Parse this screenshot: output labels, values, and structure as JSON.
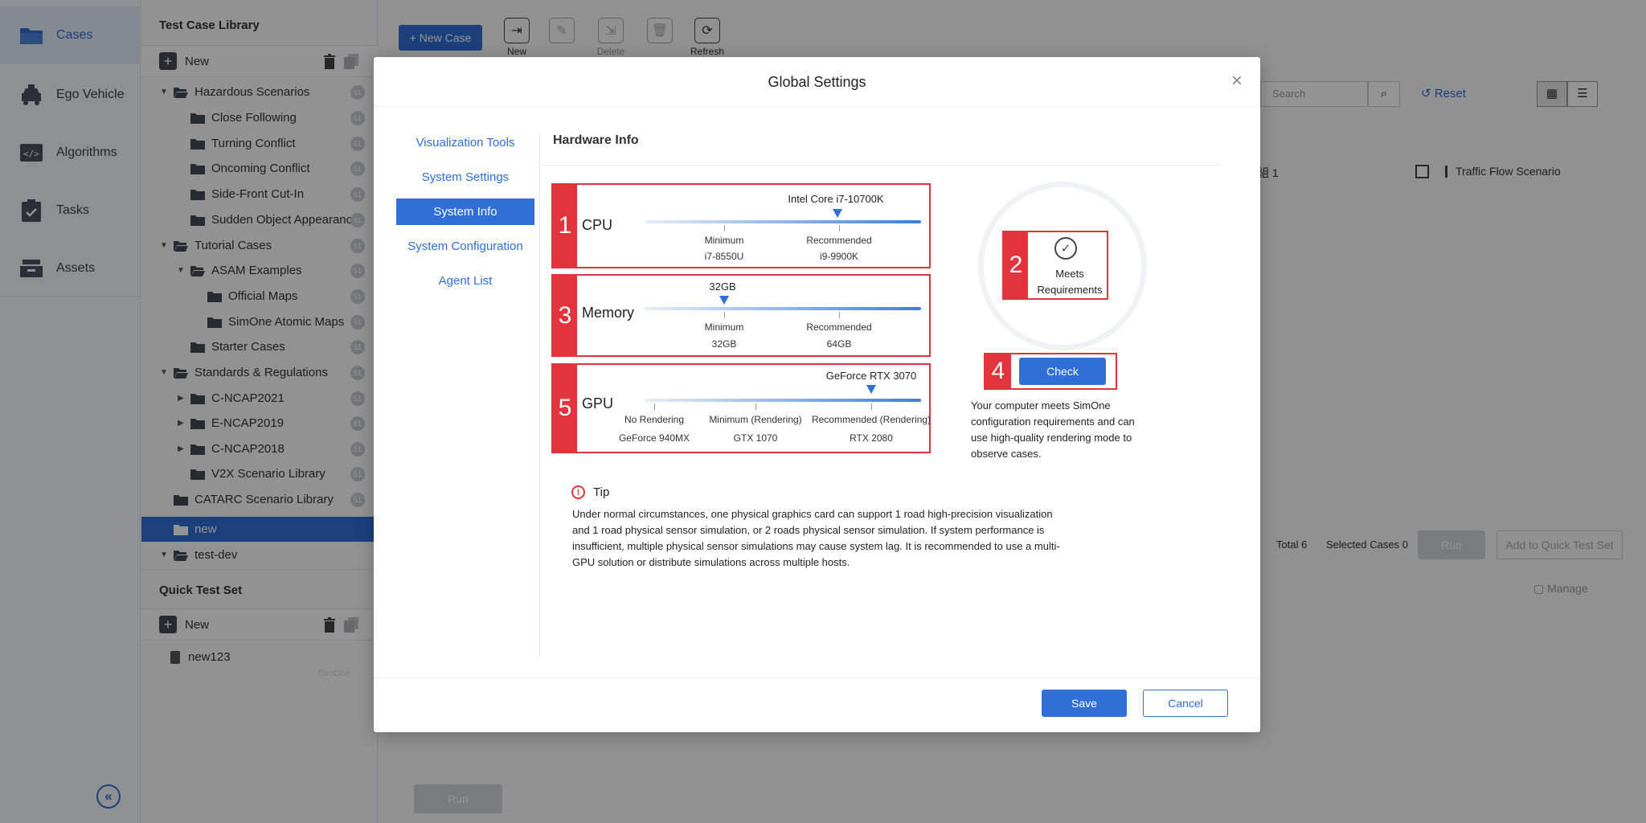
{
  "nav": {
    "items": [
      {
        "label": "Cases",
        "icon": "folder-icon"
      },
      {
        "label": "Ego Vehicle",
        "icon": "car-icon"
      },
      {
        "label": "Algorithms",
        "icon": "code-icon"
      },
      {
        "label": "Tasks",
        "icon": "clipboard-icon"
      },
      {
        "label": "Assets",
        "icon": "box-icon"
      }
    ],
    "collapse": "«"
  },
  "library": {
    "title": "Test Case Library",
    "new_label": "New",
    "items": [
      {
        "label": "Hazardous Scenarios",
        "badge": "51"
      },
      {
        "label": "Close Following",
        "badge": "51"
      },
      {
        "label": "Turning Conflict",
        "badge": "51"
      },
      {
        "label": "Oncoming Conflict",
        "badge": "51"
      },
      {
        "label": "Side-Front Cut-In",
        "badge": "51"
      },
      {
        "label": "Sudden Object Appearance",
        "badge": "51"
      },
      {
        "label": "Tutorial Cases",
        "badge": "51"
      },
      {
        "label": "ASAM Examples",
        "badge": "51"
      },
      {
        "label": "Official Maps",
        "badge": "51"
      },
      {
        "label": "SimOne Atomic Maps",
        "badge": "51"
      },
      {
        "label": "Starter Cases",
        "badge": "51"
      },
      {
        "label": "Standards & Regulations",
        "badge": "51"
      },
      {
        "label": "C-NCAP2021",
        "badge": "51"
      },
      {
        "label": "E-NCAP2019",
        "badge": "51"
      },
      {
        "label": "C-NCAP2018",
        "badge": "51"
      },
      {
        "label": "V2X Scenario Library",
        "badge": "51"
      },
      {
        "label": "CATARC Scenario Library",
        "badge": "51"
      },
      {
        "label": "new",
        "badge": ""
      },
      {
        "label": "test-dev",
        "badge": ""
      }
    ]
  },
  "quick": {
    "title": "Quick Test Set",
    "new_label": "New",
    "items": [
      {
        "label": "new123"
      }
    ],
    "watermark": "SimOne"
  },
  "toolbar": {
    "new_case": "+ New Case",
    "new": "New",
    "delete": "Delete",
    "refresh": "Refresh",
    "search_placeholder": "Search",
    "reset": "Reset"
  },
  "background_list": {
    "row_fragment": "組 1",
    "row_label": "Traffic Flow Scenario",
    "total": "Total 6",
    "selected": "Selected Cases 0",
    "run": "Run",
    "add_quick": "Add to Quick Test Set",
    "manage": "Manage",
    "bottom_run": "Run"
  },
  "modal": {
    "title": "Global Settings",
    "menu": [
      {
        "label": "Visualization Tools",
        "active": false
      },
      {
        "label": "System Settings",
        "active": false
      },
      {
        "label": "System Info",
        "active": true
      },
      {
        "label": "System Configuration",
        "active": false
      },
      {
        "label": "Agent List",
        "active": false
      }
    ],
    "section_title": "Hardware Info",
    "cpu": {
      "num": "1",
      "name": "CPU",
      "current": "Intel Core i7-10700K",
      "ticks": [
        {
          "label": "Minimum",
          "value": "i7-8550U"
        },
        {
          "label": "Recommended",
          "value": "i9-9900K"
        }
      ]
    },
    "memory": {
      "num": "3",
      "name": "Memory",
      "current": "32GB",
      "ticks": [
        {
          "label": "Minimum",
          "value": "32GB"
        },
        {
          "label": "Recommended",
          "value": "64GB"
        }
      ]
    },
    "gpu": {
      "num": "5",
      "name": "GPU",
      "current": "GeForce RTX 3070",
      "ticks": [
        {
          "label": "No Rendering",
          "value": "GeForce 940MX"
        },
        {
          "label": "Minimum (Rendering)",
          "value": "GTX 1070"
        },
        {
          "label": "Recommended (Rendering)",
          "value": "RTX 2080"
        }
      ]
    },
    "status": {
      "num": "2",
      "text": "Meets Requirements"
    },
    "check": {
      "num": "4",
      "label": "Check"
    },
    "result": "Your computer meets SimOne configuration requirements and can use high-quality rendering mode to observe cases.",
    "tip_title": "Tip",
    "tip_text": "Under normal circumstances, one physical graphics card can support 1 road high-precision visualization and 1 road physical sensor simulation, or 2 roads physical sensor simulation. If system performance is insufficient, multiple physical sensor simulations may cause system lag. It is recommended to use a multi-GPU solution or distribute simulations across multiple hosts.",
    "save": "Save",
    "cancel": "Cancel"
  },
  "colors": {
    "accent": "#2f6fd6",
    "highlight": "#e1343c"
  }
}
